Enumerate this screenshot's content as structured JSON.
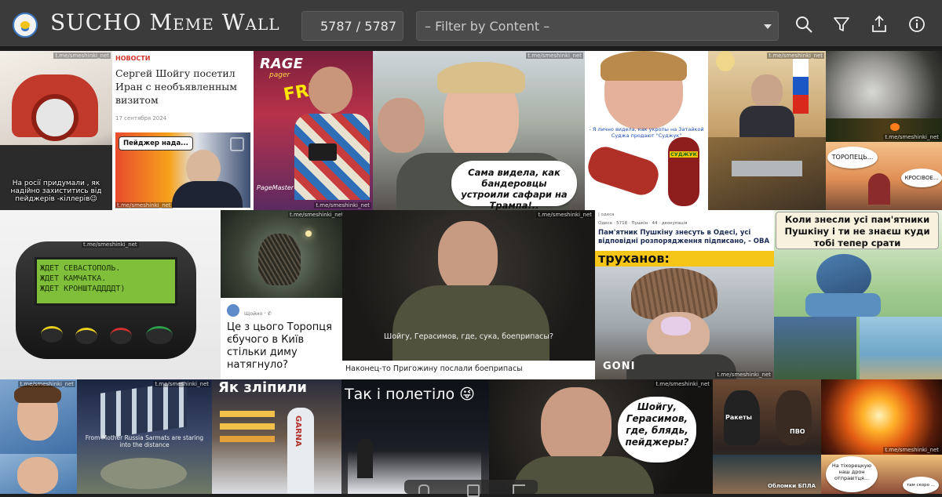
{
  "app": {
    "title": "SUCHO Meme Wall",
    "counter": "5787 / 5787",
    "filter_placeholder": "– Filter by Content –"
  },
  "icons": {
    "logo": "sucho-logo-icon",
    "search": "search-icon",
    "filter": "filter-icon",
    "share": "share-icon",
    "info": "info-icon"
  },
  "tiles": {
    "t1": {
      "caption": "На росії придумали , як надійно захиститись від пейджерів -кіллерів😉",
      "watermark": "t.me/smeshinki_net"
    },
    "t2": {
      "category": "НОВОСТИ",
      "headline": "Сергей Шойгу посетил Иран с необъявленным визитом",
      "date": "17 сентября 2024",
      "bubble": "Пейджер нада...",
      "watermark": "t.me/smeshinki_net"
    },
    "t3": {
      "masthead": "RAGE",
      "sub": "pager",
      "badge": "FREE!",
      "brand": "PageMaster",
      "watermark": "t.me/smeshinki_net"
    },
    "t4": {
      "caption": "Сама видела, как бандеровцы устроили сафари на Трампа!..",
      "watermark": "t.me/smeshinki_net"
    },
    "t5": {
      "caption": "- Я лично видела, как укропы на Затайкой Суджа продают \"Суджук\"",
      "product": "СУДЖУК"
    },
    "t6": {
      "watermark": "t.me/smeshinki_net"
    },
    "t7": {
      "watermark": "t.me/smeshinki_net"
    },
    "t8": {
      "bubble1": "ТОРОПЕЦЬ...",
      "bubble2": "КРОСІВОЕ..."
    },
    "t9": {
      "line1": "ЖДЕТ СЕВАСТОПОЛЬ.",
      "line2": "ЖДЕТ КАМЧАТКА.",
      "line3": "ЖДЕТ КРОНШТАДДДДТ)",
      "watermark": "t.me/smeshinki_net"
    },
    "t10": {
      "status": "Щойно · ✆",
      "post": "Це з цього Торопця єбучого в Київ стільки диму натягнуло?",
      "watermark": "t.me/smeshinki_net"
    },
    "t11": {
      "subtitle": "Шойгу, Герасимов, где, сука, боеприпасы?",
      "caption": "Наконец-то Пригожину послали боеприпасы",
      "watermark": "t.me/smeshinki_net"
    },
    "t12": {
      "meta": "Одеса · 5718 · Пушкін · 44 · деокупація",
      "headline": "Пам'ятник Пушкіну знесуть в Одесі, усі відповідні розпорядження підписано, - ОВА",
      "banner": "труханов:",
      "logo": "GONI",
      "watermark": "t.me/smeshinki_net"
    },
    "t13": {
      "caption": "Коли знесли усі пам'ятники Пушкіну і ти не знаєш куди тобі тепер срати"
    },
    "t14": {
      "watermark": "t.me/smeshinki_net"
    },
    "t15": {
      "caption": "From Mother Russia Sarmats are staring into the distance",
      "watermark": "t.me/smeshinki_net"
    },
    "t16": {
      "caption": "Як зліпили",
      "sign": "GARNA"
    },
    "t17": {
      "caption": "Так і полетіло 😜"
    },
    "t18": {
      "bubble": "Шойгу, Герасимов, где, блядь, пейджеры?",
      "watermark": "t.me/smeshinki_net"
    },
    "t19": {
      "label1": "Ракеты",
      "label2": "ПВО",
      "label3": "Обломки БПЛА"
    },
    "t20": {
      "watermark": "t.me/smeshinki_net"
    },
    "t21": {
      "bubble1": "На тіхорецкую наш дрон отправітця...",
      "bubble2": "там скоро ..."
    }
  }
}
